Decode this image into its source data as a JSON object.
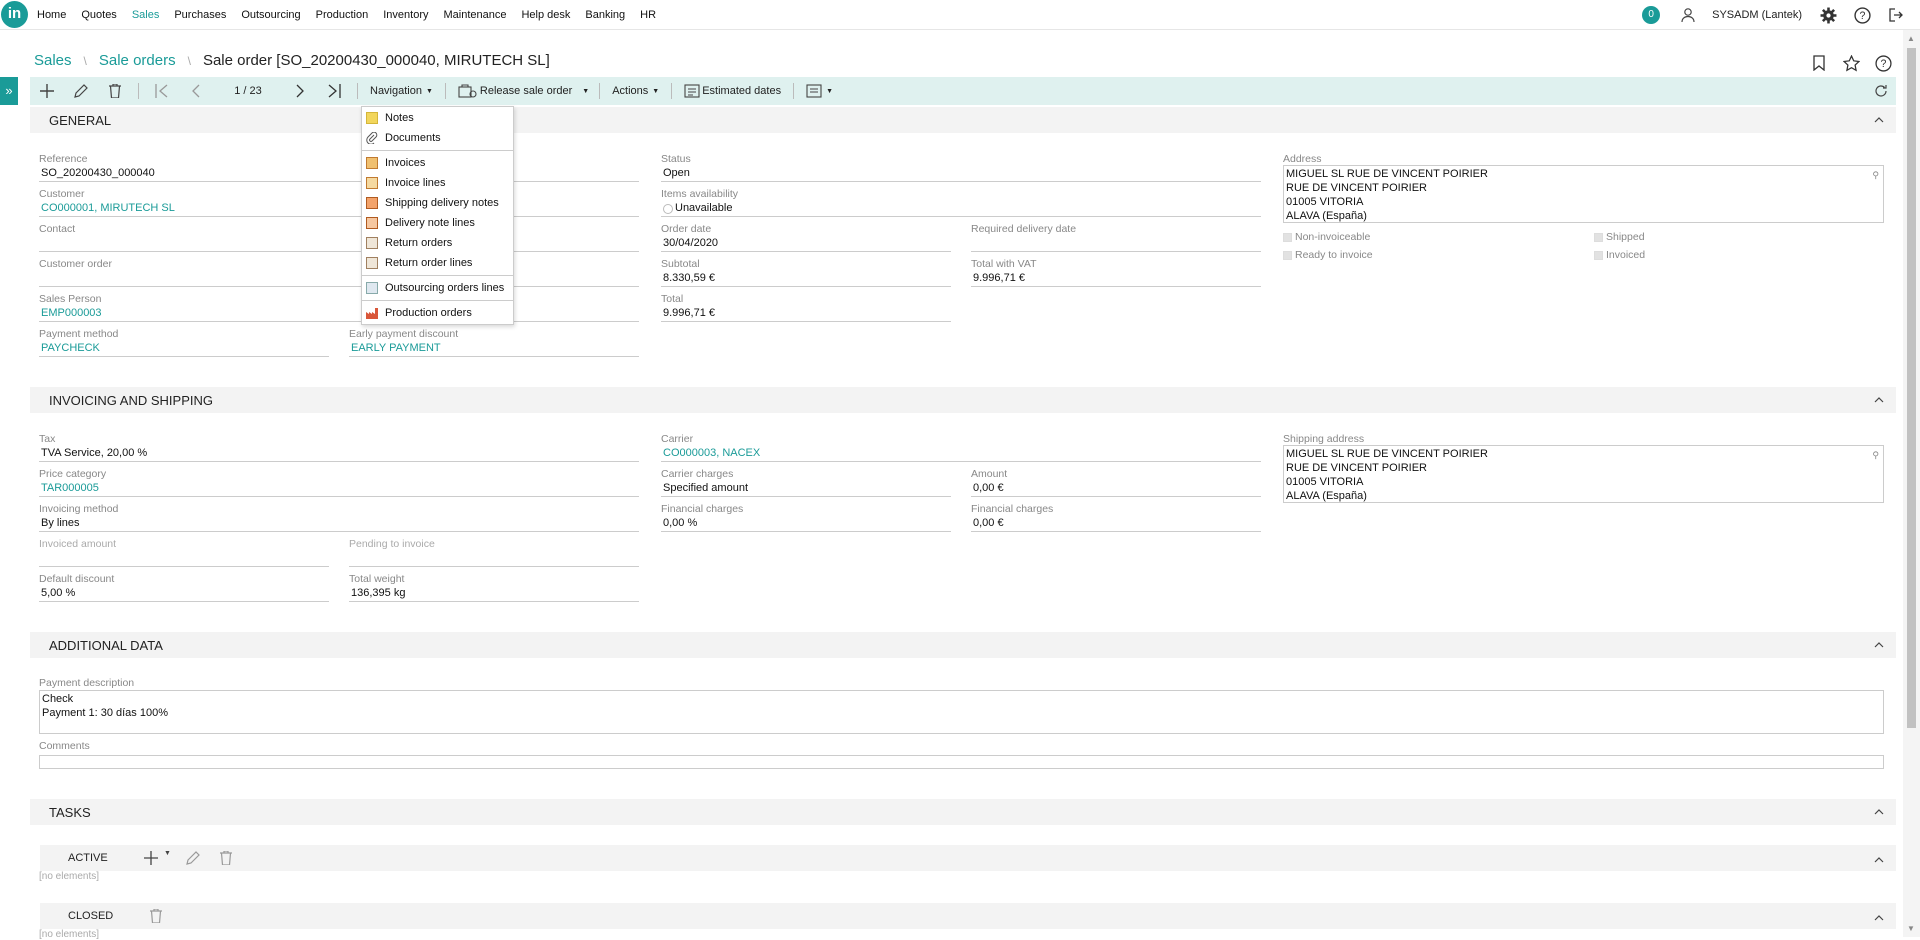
{
  "app": {
    "logo": "in"
  },
  "nav": [
    "Home",
    "Quotes",
    "Sales",
    "Purchases",
    "Outsourcing",
    "Production",
    "Inventory",
    "Maintenance",
    "Help desk",
    "Banking",
    "HR"
  ],
  "notifications": "0",
  "user": "SYSADM (Lantek)",
  "breadcrumb": {
    "sales": "Sales",
    "orders": "Sale orders",
    "title": "Sale order [SO_20200430_000040, MIRUTECH SL]"
  },
  "toolbar": {
    "pager": "1 / 23",
    "navigation": "Navigation",
    "release": "Release sale order",
    "actions": "Actions",
    "estimated": "Estimated dates"
  },
  "navmenu": [
    "Notes",
    "Documents",
    "Invoices",
    "Invoice lines",
    "Shipping delivery notes",
    "Delivery note lines",
    "Return orders",
    "Return order lines",
    "Outsourcing orders lines",
    "Production orders"
  ],
  "general": {
    "title": "GENERAL",
    "reference_lbl": "Reference",
    "reference": "SO_20200430_000040",
    "customer_lbl": "Customer",
    "customer": "CO000001, MIRUTECH SL",
    "contact_lbl": "Contact",
    "contact": "",
    "custorder_lbl": "Customer order",
    "custorder": "",
    "salesperson_lbl": "Sales Person",
    "salesperson": "EMP000003",
    "paymethod_lbl": "Payment method",
    "paymethod": "PAYCHECK",
    "earlypay_lbl": "Early payment discount",
    "earlypay": "EARLY PAYMENT",
    "status_lbl": "Status",
    "status": "Open",
    "items_lbl": "Items availability",
    "items": "Unavailable",
    "orderdate_lbl": "Order date",
    "orderdate": "30/04/2020",
    "reqdate_lbl": "Required delivery date",
    "reqdate": "",
    "subtotal_lbl": "Subtotal",
    "subtotal": "8.330,59 €",
    "totalvat_lbl": "Total with VAT",
    "totalvat": "9.996,71 €",
    "total_lbl": "Total",
    "total": "9.996,71 €",
    "address_lbl": "Address",
    "address": [
      "MIGUEL SL RUE DE VINCENT POIRIER",
      "RUE DE VINCENT POIRIER",
      "01005  VITORIA",
      "ALAVA  (España)"
    ],
    "noninvoiceable": "Non-invoiceable",
    "shipped": "Shipped",
    "readyinvoice": "Ready to invoice",
    "invoiced": "Invoiced"
  },
  "invoicing": {
    "title": "INVOICING AND SHIPPING",
    "tax_lbl": "Tax",
    "tax": "TVA Service, 20,00 %",
    "pricecat_lbl": "Price category",
    "pricecat": "TAR000005",
    "invmethod_lbl": "Invoicing method",
    "invmethod": "By lines",
    "invamount_lbl": "Invoiced amount",
    "invamount": "",
    "pending_lbl": "Pending to invoice",
    "pending": "",
    "defdisc_lbl": "Default discount",
    "defdisc": "5,00 %",
    "weight_lbl": "Total weight",
    "weight": "136,395 kg",
    "carrier_lbl": "Carrier",
    "carrier": "CO000003, NACEX",
    "carriercharges_lbl": "Carrier charges",
    "carriercharges": "Specified amount",
    "amount_lbl": "Amount",
    "amount": "0,00 €",
    "fincharges_lbl": "Financial charges",
    "fincharges": "0,00 %",
    "fincharges2_lbl": "Financial charges",
    "fincharges2": "0,00 €",
    "shipaddr_lbl": "Shipping address",
    "shipaddr": [
      "MIGUEL SL RUE DE VINCENT POIRIER",
      "RUE DE VINCENT POIRIER",
      "01005  VITORIA",
      "ALAVA  (España)"
    ]
  },
  "additional": {
    "title": "ADDITIONAL DATA",
    "paydesc_lbl": "Payment description",
    "paydesc": [
      "Check",
      "Payment 1: 30 días 100%"
    ],
    "comments_lbl": "Comments"
  },
  "tasks": {
    "title": "TASKS",
    "active": "ACTIVE",
    "closed": "CLOSED",
    "noelements": "[no elements]"
  }
}
